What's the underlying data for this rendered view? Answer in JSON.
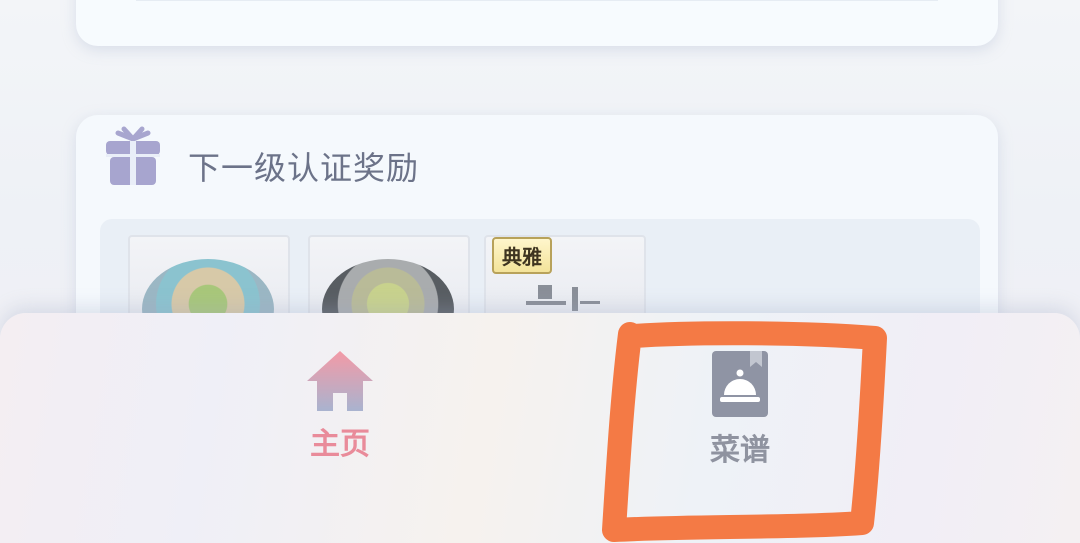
{
  "reward_card": {
    "title": "下一级认证奖励",
    "items": [
      {
        "icon": "dish-salad"
      },
      {
        "icon": "dish-pasta"
      },
      {
        "icon": "furniture-set",
        "badge": "典雅"
      }
    ]
  },
  "bottom_nav": {
    "items": [
      {
        "label": "主页",
        "icon": "home-icon",
        "active": true,
        "color": "#e98b9a"
      },
      {
        "label": "菜谱",
        "icon": "recipe-book-icon",
        "active": false,
        "color": "#8f93a0"
      }
    ]
  },
  "annotation": {
    "color": "#f47a45",
    "shape": "hand-drawn-rectangle",
    "target": "菜谱"
  }
}
